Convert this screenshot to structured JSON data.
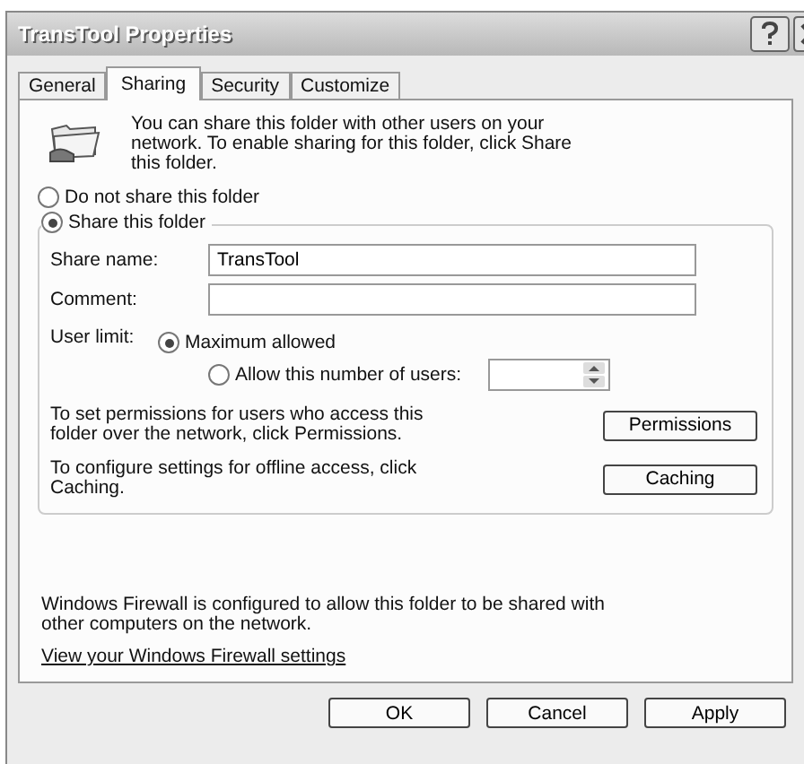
{
  "window": {
    "title": "TransTool Properties"
  },
  "tabs": [
    {
      "label": "General",
      "selected": false
    },
    {
      "label": "Sharing",
      "selected": true
    },
    {
      "label": "Security",
      "selected": false
    },
    {
      "label": "Customize",
      "selected": false
    }
  ],
  "intro": "You can share this folder with other users on your network.  To enable sharing for this folder, click Share this folder.",
  "share_options": [
    {
      "label": "Do not share this folder",
      "selected": false
    },
    {
      "label": "Share this folder",
      "selected": true
    }
  ],
  "fields": [
    {
      "label": "Share name:",
      "value": "TransTool"
    },
    {
      "label": "Comment:"
    }
  ],
  "user_limit": {
    "label": "User limit:",
    "options": [
      {
        "label": "Maximum allowed",
        "selected": true
      },
      {
        "label": "Allow this number of users:",
        "selected": false
      }
    ]
  },
  "actions": [
    {
      "text": "To set permissions for users who access this folder over the network, click Permissions.",
      "button": "Permissions"
    },
    {
      "text": "To configure settings for offline access, click Caching.",
      "button": "Caching"
    }
  ],
  "firewall_note": "Windows Firewall is configured to allow this folder to be shared with other computers on the network.",
  "firewall_link": "View your Windows Firewall settings",
  "buttons": [
    "OK",
    "Cancel",
    "Apply"
  ]
}
